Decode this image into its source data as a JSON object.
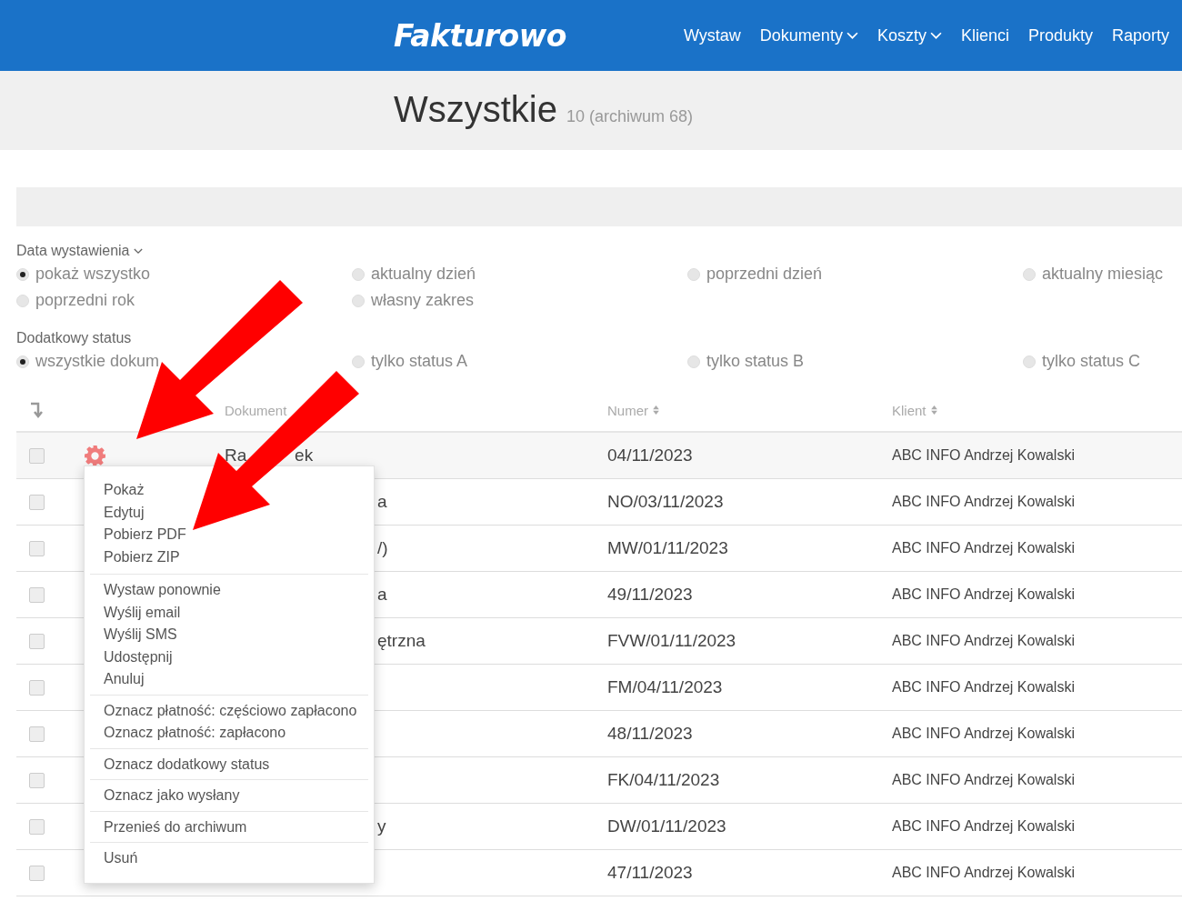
{
  "brand": "Fakturowo",
  "nav": [
    {
      "label": "Wystaw",
      "dropdown": false
    },
    {
      "label": "Dokumenty",
      "dropdown": true
    },
    {
      "label": "Koszty",
      "dropdown": true
    },
    {
      "label": "Klienci",
      "dropdown": false
    },
    {
      "label": "Produkty",
      "dropdown": false
    },
    {
      "label": "Raporty",
      "dropdown": false
    }
  ],
  "page": {
    "title": "Wszystkie",
    "count": "10 (archiwum 68)"
  },
  "filters": [
    {
      "label": "Data wystawienia",
      "dropdown": true,
      "options": [
        {
          "label": "pokaż wszystko",
          "selected": true
        },
        {
          "label": "aktualny dzień",
          "selected": false
        },
        {
          "label": "poprzedni dzień",
          "selected": false
        },
        {
          "label": "aktualny miesiąc",
          "selected": false
        },
        {
          "label": "poprzedni rok",
          "selected": false
        },
        {
          "label": "własny zakres",
          "selected": false
        }
      ]
    },
    {
      "label": "Dodatkowy status",
      "dropdown": false,
      "options": [
        {
          "label": "wszystkie dokum",
          "selected": true
        },
        {
          "label": "tylko status A",
          "selected": false
        },
        {
          "label": "tylko status B",
          "selected": false
        },
        {
          "label": "tylko status C",
          "selected": false
        }
      ]
    }
  ],
  "table": {
    "columns": [
      {
        "label": "Dokument",
        "sortable": false
      },
      {
        "label": "Numer",
        "sortable": true
      },
      {
        "label": "Klient",
        "sortable": true
      }
    ],
    "rows": [
      {
        "checked": false,
        "document": "Ra          ek",
        "numer": "04/11/2023",
        "klient": "ABC INFO Andrzej Kowalski"
      },
      {
        "checked": false,
        "document_tail": "a",
        "numer": "NO/03/11/2023",
        "klient": "ABC INFO Andrzej Kowalski"
      },
      {
        "checked": false,
        "document_tail": "/)",
        "numer": "MW/01/11/2023",
        "klient": "ABC INFO Andrzej Kowalski"
      },
      {
        "checked": false,
        "document_tail": "a",
        "numer": "49/11/2023",
        "klient": "ABC INFO Andrzej Kowalski"
      },
      {
        "checked": false,
        "document_tail": "ętrzna",
        "numer": "FVW/01/11/2023",
        "klient": "ABC INFO Andrzej Kowalski"
      },
      {
        "checked": false,
        "numer": "FM/04/11/2023",
        "klient": "ABC INFO Andrzej Kowalski"
      },
      {
        "checked": false,
        "numer": "48/11/2023",
        "klient": "ABC INFO Andrzej Kowalski"
      },
      {
        "checked": false,
        "numer": "FK/04/11/2023",
        "klient": "ABC INFO Andrzej Kowalski"
      },
      {
        "checked": false,
        "document_tail": "y",
        "numer": "DW/01/11/2023",
        "klient": "ABC INFO Andrzej Kowalski"
      },
      {
        "checked": false,
        "numer": "47/11/2023",
        "klient": "ABC INFO Andrzej Kowalski"
      }
    ]
  },
  "context_menu": {
    "groups": [
      [
        "Pokaż",
        "Edytuj",
        "Pobierz PDF",
        "Pobierz ZIP"
      ],
      [
        "Wystaw ponownie",
        "Wyślij email",
        "Wyślij SMS",
        "Udostępnij",
        "Anuluj"
      ],
      [
        "Oznacz płatność: częściowo zapłacono",
        "Oznacz płatność: zapłacono"
      ],
      [
        "Oznacz dodatkowy status"
      ],
      [
        "Oznacz jako wysłany"
      ],
      [
        "Przenieś do archiwum"
      ],
      [
        "Usuń"
      ]
    ]
  }
}
